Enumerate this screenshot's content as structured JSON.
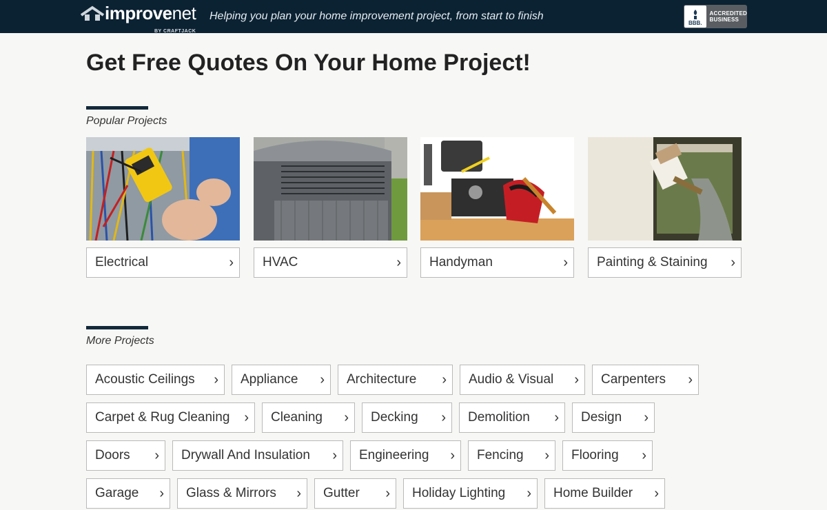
{
  "header": {
    "logo_main": "improve",
    "logo_suffix": "net",
    "logo_by": "BY CRAFTJACK",
    "tagline": "Helping you plan your home improvement project, from start to finish",
    "bbb_seal": "BBB.",
    "bbb_line1": "ACCREDITED",
    "bbb_line2": "BUSINESS"
  },
  "page": {
    "title": "Get Free Quotes On Your Home Project!"
  },
  "popular": {
    "label": "Popular Projects",
    "items": [
      {
        "label": "Electrical"
      },
      {
        "label": "HVAC"
      },
      {
        "label": "Handyman"
      },
      {
        "label": "Painting & Staining"
      }
    ]
  },
  "more": {
    "label": "More Projects",
    "rows": [
      [
        {
          "label": "Acoustic Ceilings"
        },
        {
          "label": "Appliance"
        },
        {
          "label": "Architecture"
        },
        {
          "label": "Audio & Visual"
        },
        {
          "label": "Carpenters"
        }
      ],
      [
        {
          "label": "Carpet & Rug Cleaning"
        },
        {
          "label": "Cleaning"
        },
        {
          "label": "Decking"
        },
        {
          "label": "Demolition"
        },
        {
          "label": "Design"
        }
      ],
      [
        {
          "label": "Doors"
        },
        {
          "label": "Drywall And Insulation"
        },
        {
          "label": "Engineering"
        },
        {
          "label": "Fencing"
        },
        {
          "label": "Flooring"
        }
      ],
      [
        {
          "label": "Garage"
        },
        {
          "label": "Glass & Mirrors"
        },
        {
          "label": "Gutter"
        },
        {
          "label": "Holiday Lighting"
        },
        {
          "label": "Home Builder"
        }
      ]
    ]
  },
  "icons": {
    "chevron": "chevron-right-icon",
    "logo": "house-roof-icon"
  },
  "colors": {
    "header_bg": "#0b2233",
    "accent_rule": "#12293a",
    "page_bg": "#f7f7f5",
    "button_border": "#b9b9b9"
  }
}
